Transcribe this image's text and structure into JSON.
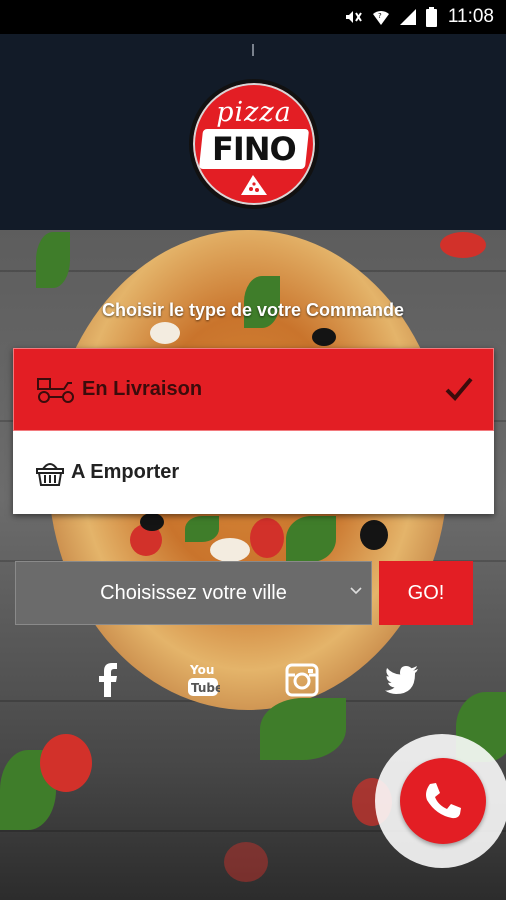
{
  "status_bar": {
    "time": "11:08",
    "icons": [
      "mute-icon",
      "wifi-icon",
      "cell-signal-icon",
      "battery-icon"
    ]
  },
  "brand": {
    "logo_top_text": "pizza",
    "logo_main_text": "FINO",
    "color_primary": "#e31e24",
    "color_header": "#121b28"
  },
  "order": {
    "headline": "Choisir le type de votre Commande",
    "options": [
      {
        "label": "En Livraison",
        "icon": "delivery-scooter-icon",
        "selected": true
      },
      {
        "label": "A Emporter",
        "icon": "basket-icon",
        "selected": false
      }
    ]
  },
  "city": {
    "placeholder": "Choisissez votre ville",
    "go_label": "GO!"
  },
  "social": [
    "facebook-icon",
    "youtube-icon",
    "instagram-icon",
    "twitter-icon"
  ],
  "call_button": {
    "icon": "phone-icon"
  }
}
